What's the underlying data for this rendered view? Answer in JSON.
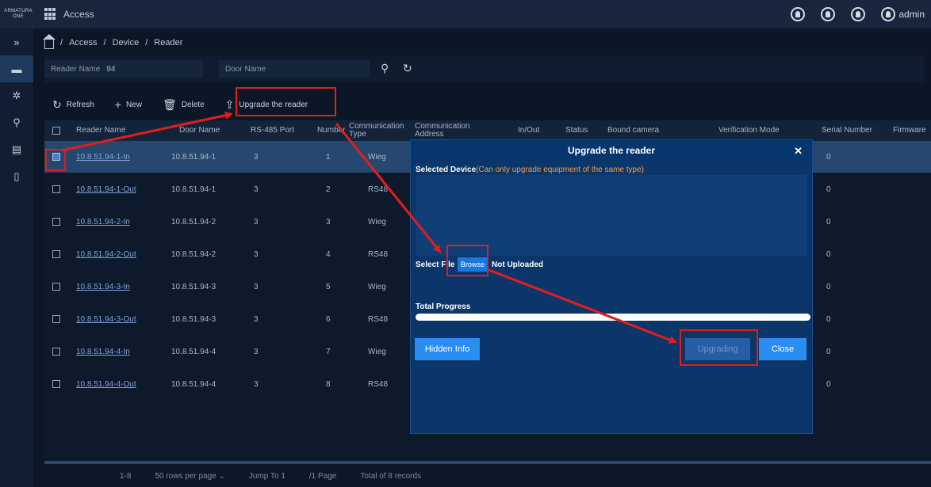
{
  "topbar": {
    "logo_text": "ARMATURA ONE",
    "app_name": "Access",
    "user": "admin",
    "icons": [
      "headset-icon",
      "bell-icon",
      "operator-icon",
      "user-icon"
    ]
  },
  "sidebar": {
    "items": [
      "expand-icon",
      "access-icon",
      "gear-icon",
      "key-icon",
      "report-icon",
      "device-icon"
    ]
  },
  "breadcrumb": [
    "Access",
    "Device",
    "Reader"
  ],
  "filter": {
    "reader_name_label": "Reader Name",
    "reader_name_value": "94",
    "door_name_label": "Door Name"
  },
  "toolbar": {
    "refresh": "Refresh",
    "new": "New",
    "delete": "Delete",
    "upgrade": "Upgrade the reader"
  },
  "table": {
    "columns": [
      "Reader Name",
      "Door Name",
      "RS-485 Port",
      "Number",
      "Communication Type",
      "Communication Address",
      "In/Out",
      "Status",
      "Bound camera",
      "Verification Mode",
      "Serial Number",
      "Firmware"
    ],
    "rows": [
      {
        "reader": "10.8.51.94-1-In",
        "door": "10.8.51.94-1",
        "port": "3",
        "number": "1",
        "comm": "Wieg",
        "serial": "0",
        "selected": true
      },
      {
        "reader": "10.8.51.94-1-Out",
        "door": "10.8.51.94-1",
        "port": "3",
        "number": "2",
        "comm": "RS48",
        "serial": "0",
        "selected": false
      },
      {
        "reader": "10.8.51.94-2-In",
        "door": "10.8.51.94-2",
        "port": "3",
        "number": "3",
        "comm": "Wieg",
        "serial": "0",
        "selected": false
      },
      {
        "reader": "10.8.51.94-2-Out",
        "door": "10.8.51.94-2",
        "port": "3",
        "number": "4",
        "comm": "RS48",
        "serial": "0",
        "selected": false
      },
      {
        "reader": "10.8.51.94-3-In",
        "door": "10.8.51.94-3",
        "port": "3",
        "number": "5",
        "comm": "Wieg",
        "serial": "0",
        "selected": false
      },
      {
        "reader": "10.8.51.94-3-Out",
        "door": "10.8.51.94-3",
        "port": "3",
        "number": "6",
        "comm": "RS48",
        "serial": "0",
        "selected": false
      },
      {
        "reader": "10.8.51.94-4-In",
        "door": "10.8.51.94-4",
        "port": "3",
        "number": "7",
        "comm": "Wieg",
        "serial": "0",
        "selected": false
      },
      {
        "reader": "10.8.51.94-4-Out",
        "door": "10.8.51.94-4",
        "port": "3",
        "number": "8",
        "comm": "RS48",
        "serial": "0",
        "selected": false
      }
    ]
  },
  "pagination": {
    "range": "1-8",
    "rows_per_page": "50 rows per page",
    "jump_to_label": "Jump To",
    "jump_to_value": "1",
    "pages": "/1 Page",
    "total": "Total of 8 records"
  },
  "modal": {
    "title": "Upgrade the reader",
    "selected_device_label": "Selected Device",
    "selected_device_note": "(Can only upgrade equipment of the same type)",
    "select_file_label": "Select File",
    "browse": "Browse",
    "file_status": "Not Uploaded",
    "total_progress_label": "Total Progress",
    "total_progress": 1.0,
    "hidden_info": "Hidden Info",
    "upgrading": "Upgrading",
    "close": "Close"
  },
  "colors": {
    "annotation": "#e21d1d",
    "accent": "#2a8df0",
    "note": "#f0a04c"
  }
}
